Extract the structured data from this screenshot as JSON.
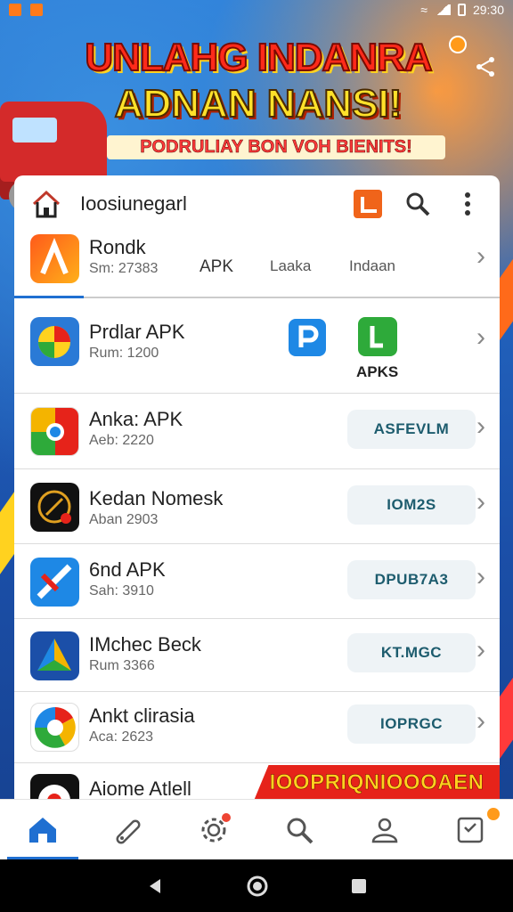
{
  "status_bar": {
    "time": "29:30"
  },
  "banner": {
    "line1": "UNLAHG INDANRA",
    "line2": "ADNAN NANSI!",
    "line3": "PODRULIAY BON VOH BIENITS!"
  },
  "header": {
    "title": "Ioosiunegarl"
  },
  "list": [
    {
      "name": "Rondk",
      "sub": "Sm: 27383",
      "tabs": [
        "APK",
        "Laaka",
        "Indaan"
      ]
    },
    {
      "name": "Prdlar APK",
      "sub": "Rum: 1200",
      "badge": "APKS"
    },
    {
      "name": "Anka: APK",
      "sub": "Aeb: 2220",
      "action": "ASFEVLM"
    },
    {
      "name": "Kedan Nomesk",
      "sub": "Aban 2903",
      "action": "IOM2S"
    },
    {
      "name": "6nd APK",
      "sub": "Sah: 3910",
      "action": "DPUB7A3"
    },
    {
      "name": "IMchec Beck",
      "sub": "Rum 3366",
      "action": "KT.MGC"
    },
    {
      "name": "Ankt clirasia",
      "sub": "Aca: 2623",
      "action": "IOPRGC"
    },
    {
      "name": "Aiome Atlell",
      "sub": ""
    }
  ],
  "promo": "IOOPRIQNIOOOAEN",
  "bottom_nav": [
    "home",
    "tag",
    "settings",
    "search",
    "profile",
    "tasks"
  ],
  "colors": {
    "accent": "#1f6fd1",
    "promo_bg": "#e6231a",
    "promo_text": "#ffd21f"
  }
}
